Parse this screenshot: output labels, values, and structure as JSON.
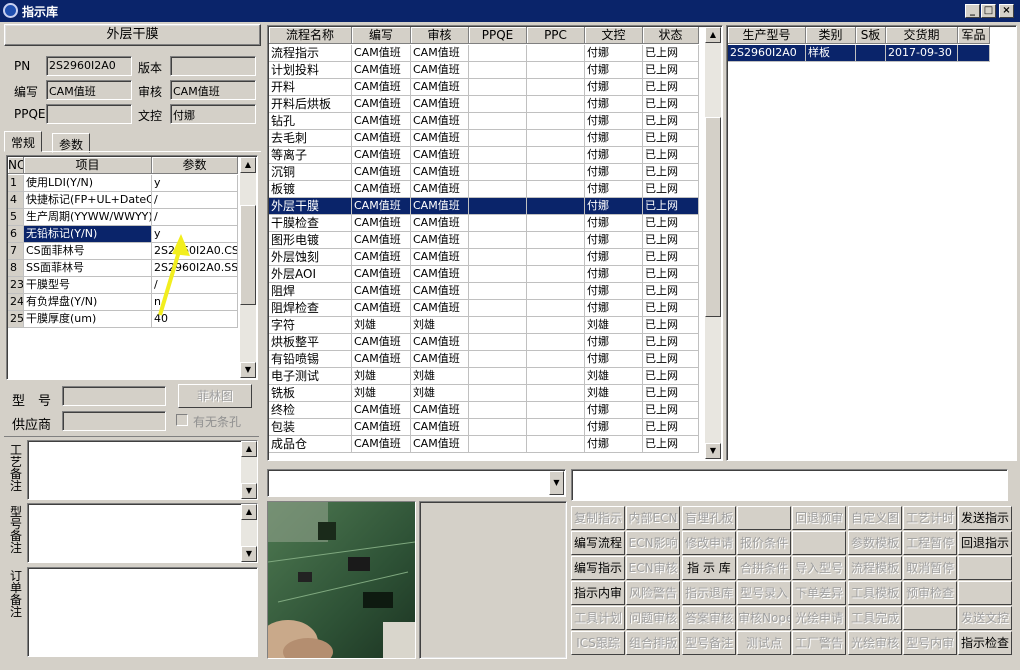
{
  "window": {
    "title": "指示库",
    "min": "_",
    "max": "□",
    "close": "×"
  },
  "left": {
    "heading": "外层干膜",
    "pn_label": "PN",
    "pn_value": "2S2960I2A0",
    "version_label": "版本",
    "version_value": "",
    "write_label": "编写",
    "write_value": "CAM值班",
    "audit_label": "审核",
    "audit_value": "CAM值班",
    "ppqe_label": "PPQE",
    "ppqe_value": "",
    "doc_label": "文控",
    "doc_value": "付娜",
    "tabs": [
      "常规",
      "参数"
    ],
    "param_headers": [
      "NO",
      "项目",
      "参数"
    ],
    "params": [
      {
        "no": "1",
        "item": "使用LDI(Y/N)",
        "val": "y"
      },
      {
        "no": "4",
        "item": "快捷标记(FP+UL+DateC",
        "val": "/"
      },
      {
        "no": "5",
        "item": "生产周期(YYWW/WWYY)",
        "val": "/"
      },
      {
        "no": "6",
        "item": "无铅标记(Y/N)",
        "val": "y"
      },
      {
        "no": "7",
        "item": "CS面菲林号",
        "val": "2S2960I2A0.CS"
      },
      {
        "no": "8",
        "item": "SS面菲林号",
        "val": "2S2960I2A0.SS"
      },
      {
        "no": "23",
        "item": "干膜型号",
        "val": "/"
      },
      {
        "no": "24",
        "item": "有负焊盘(Y/N)",
        "val": "n"
      },
      {
        "no": "25",
        "item": "干膜厚度(um)",
        "val": "40"
      }
    ],
    "model_label": "型　号",
    "model_value": "",
    "film_button": "菲林图",
    "supplier_label": "供应商",
    "supplier_value": "",
    "stripe_checkbox": "有无条孔",
    "craft_note_label": "工艺备注",
    "model_note_label": "型号备注",
    "order_note_label": "订单备注"
  },
  "flow": {
    "headers": [
      "流程名称",
      "编写",
      "审核",
      "PPQE",
      "PPC",
      "文控",
      "状态"
    ],
    "rows": [
      [
        "流程指示",
        "CAM值班",
        "CAM值班",
        "",
        "",
        "付娜",
        "已上网"
      ],
      [
        "计划投料",
        "CAM值班",
        "CAM值班",
        "",
        "",
        "付娜",
        "已上网"
      ],
      [
        "开料",
        "CAM值班",
        "CAM值班",
        "",
        "",
        "付娜",
        "已上网"
      ],
      [
        "开料后烘板",
        "CAM值班",
        "CAM值班",
        "",
        "",
        "付娜",
        "已上网"
      ],
      [
        "钻孔",
        "CAM值班",
        "CAM值班",
        "",
        "",
        "付娜",
        "已上网"
      ],
      [
        "去毛刺",
        "CAM值班",
        "CAM值班",
        "",
        "",
        "付娜",
        "已上网"
      ],
      [
        "等离子",
        "CAM值班",
        "CAM值班",
        "",
        "",
        "付娜",
        "已上网"
      ],
      [
        "沉铜",
        "CAM值班",
        "CAM值班",
        "",
        "",
        "付娜",
        "已上网"
      ],
      [
        "板镀",
        "CAM值班",
        "CAM值班",
        "",
        "",
        "付娜",
        "已上网"
      ],
      [
        "外层干膜",
        "CAM值班",
        "CAM值班",
        "",
        "",
        "付娜",
        "已上网"
      ],
      [
        "干膜检查",
        "CAM值班",
        "CAM值班",
        "",
        "",
        "付娜",
        "已上网"
      ],
      [
        "图形电镀",
        "CAM值班",
        "CAM值班",
        "",
        "",
        "付娜",
        "已上网"
      ],
      [
        "外层蚀刻",
        "CAM值班",
        "CAM值班",
        "",
        "",
        "付娜",
        "已上网"
      ],
      [
        "外层AOI",
        "CAM值班",
        "CAM值班",
        "",
        "",
        "付娜",
        "已上网"
      ],
      [
        "阻焊",
        "CAM值班",
        "CAM值班",
        "",
        "",
        "付娜",
        "已上网"
      ],
      [
        "阻焊检查",
        "CAM值班",
        "CAM值班",
        "",
        "",
        "付娜",
        "已上网"
      ],
      [
        "字符",
        "刘雄",
        "刘雄",
        "",
        "",
        "刘雄",
        "已上网"
      ],
      [
        "烘板整平",
        "CAM值班",
        "CAM值班",
        "",
        "",
        "付娜",
        "已上网"
      ],
      [
        "有铅喷锡",
        "CAM值班",
        "CAM值班",
        "",
        "",
        "付娜",
        "已上网"
      ],
      [
        "电子测试",
        "刘雄",
        "刘雄",
        "",
        "",
        "刘雄",
        "已上网"
      ],
      [
        "铣板",
        "刘雄",
        "刘雄",
        "",
        "",
        "刘雄",
        "已上网"
      ],
      [
        "终检",
        "CAM值班",
        "CAM值班",
        "",
        "",
        "付娜",
        "已上网"
      ],
      [
        "包装",
        "CAM值班",
        "CAM值班",
        "",
        "",
        "付娜",
        "已上网"
      ],
      [
        "成品仓",
        "CAM值班",
        "CAM值班",
        "",
        "",
        "付娜",
        "已上网"
      ]
    ],
    "selected_row": 9
  },
  "orders": {
    "headers": [
      "生产型号",
      "类别",
      "S板",
      "交货期",
      "军品"
    ],
    "rows": [
      [
        "2S2960I2A0",
        "样板",
        "",
        "2017-09-30",
        ""
      ]
    ]
  },
  "buttons": [
    [
      "复制指示",
      "内部ECN",
      "盲埋孔板",
      "",
      "回退预审",
      "自定义图",
      "工艺计时",
      "发送指示"
    ],
    [
      "编写流程",
      "ECN影响",
      "修改申请",
      "报价条件",
      "",
      "参数模板",
      "工程暂停",
      "回退指示"
    ],
    [
      "编写指示",
      "ECN审核",
      "指 示 库",
      "合拼条件",
      "导入型号",
      "流程模板",
      "取消暂停",
      ""
    ],
    [
      "指示内审",
      "风险警告",
      "指示退库",
      "型号录入",
      "下单差异",
      "工具模板",
      "预审检查",
      ""
    ],
    [
      "工具计划",
      "问题审核",
      "答案审核",
      "审核Nope",
      "光绘申请",
      "工具完成",
      "",
      "发送文控"
    ],
    [
      "ICS跟踪",
      "组合排版",
      "型号备注",
      "测试点",
      "工厂警告",
      "光绘审核",
      "型号内审",
      "指示检查"
    ]
  ],
  "enabled_buttons": [
    "发送指示",
    "编写流程",
    "回退指示",
    "编写指示",
    "指 示 库",
    "指示内审",
    "指示检查"
  ]
}
